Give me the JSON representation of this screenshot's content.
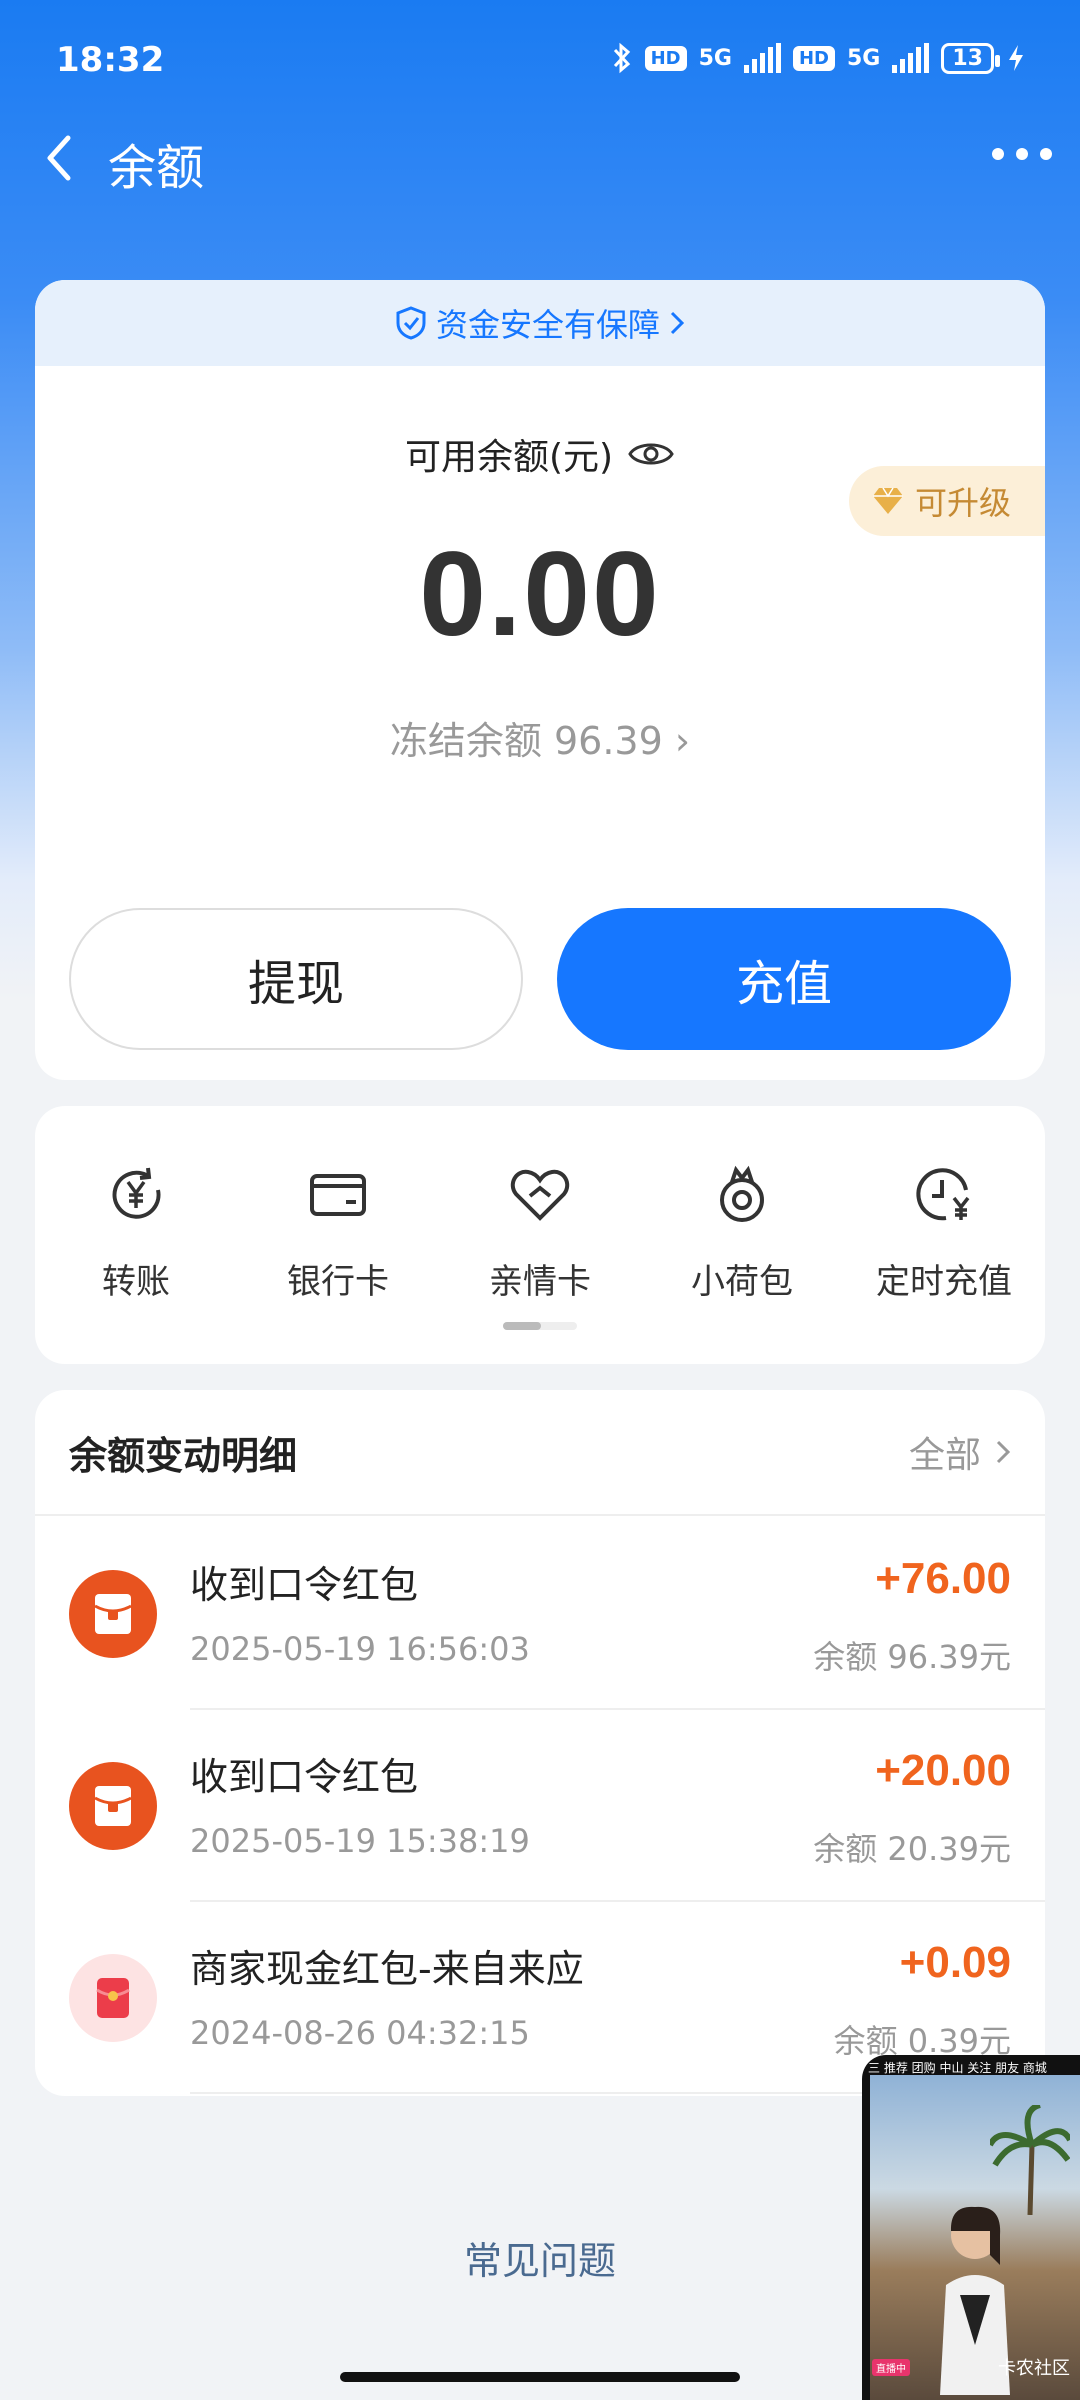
{
  "status_bar": {
    "time": "18:32",
    "network_1": "5G",
    "network_2": "5G",
    "hd_1": "HD",
    "hd_2": "HD",
    "battery": "13"
  },
  "header": {
    "title": "余额"
  },
  "balance": {
    "safety_text": "资金安全有保障",
    "available_label": "可用余额(元)",
    "upgrade_label": "可升级",
    "amount": "0.00",
    "frozen_label": "冻结余额 96.39",
    "withdraw_label": "提现",
    "recharge_label": "充值"
  },
  "actions": [
    {
      "label": "转账",
      "icon": "transfer-yuan-icon"
    },
    {
      "label": "银行卡",
      "icon": "bank-card-icon"
    },
    {
      "label": "亲情卡",
      "icon": "family-card-icon"
    },
    {
      "label": "小荷包",
      "icon": "small-pouch-icon"
    },
    {
      "label": "定时充值",
      "icon": "scheduled-recharge-icon"
    }
  ],
  "transactions": {
    "title": "余额变动明细",
    "filter_label": "全部",
    "items": [
      {
        "name": "收到口令红包",
        "date": "2025-05-19 16:56:03",
        "amount": "+76.00",
        "balance": "余额 96.39元"
      },
      {
        "name": "收到口令红包",
        "date": "2025-05-19 15:38:19",
        "amount": "+20.00",
        "balance": "余额 20.39元"
      },
      {
        "name": "商家现金红包-来自来应",
        "date": "2024-08-26 04:32:15",
        "amount": "+0.09",
        "balance": "余额 0.39元"
      }
    ]
  },
  "faq_label": "常见问题",
  "pip": {
    "tabs": "三  推荐  团购  中山  关注  朋友  商城",
    "live_badge": "直播中",
    "label": "卡农社区"
  },
  "colors": {
    "primary": "#1677ff",
    "amount_positive": "#f0641e",
    "upgrade_gold": "#c58a34"
  }
}
